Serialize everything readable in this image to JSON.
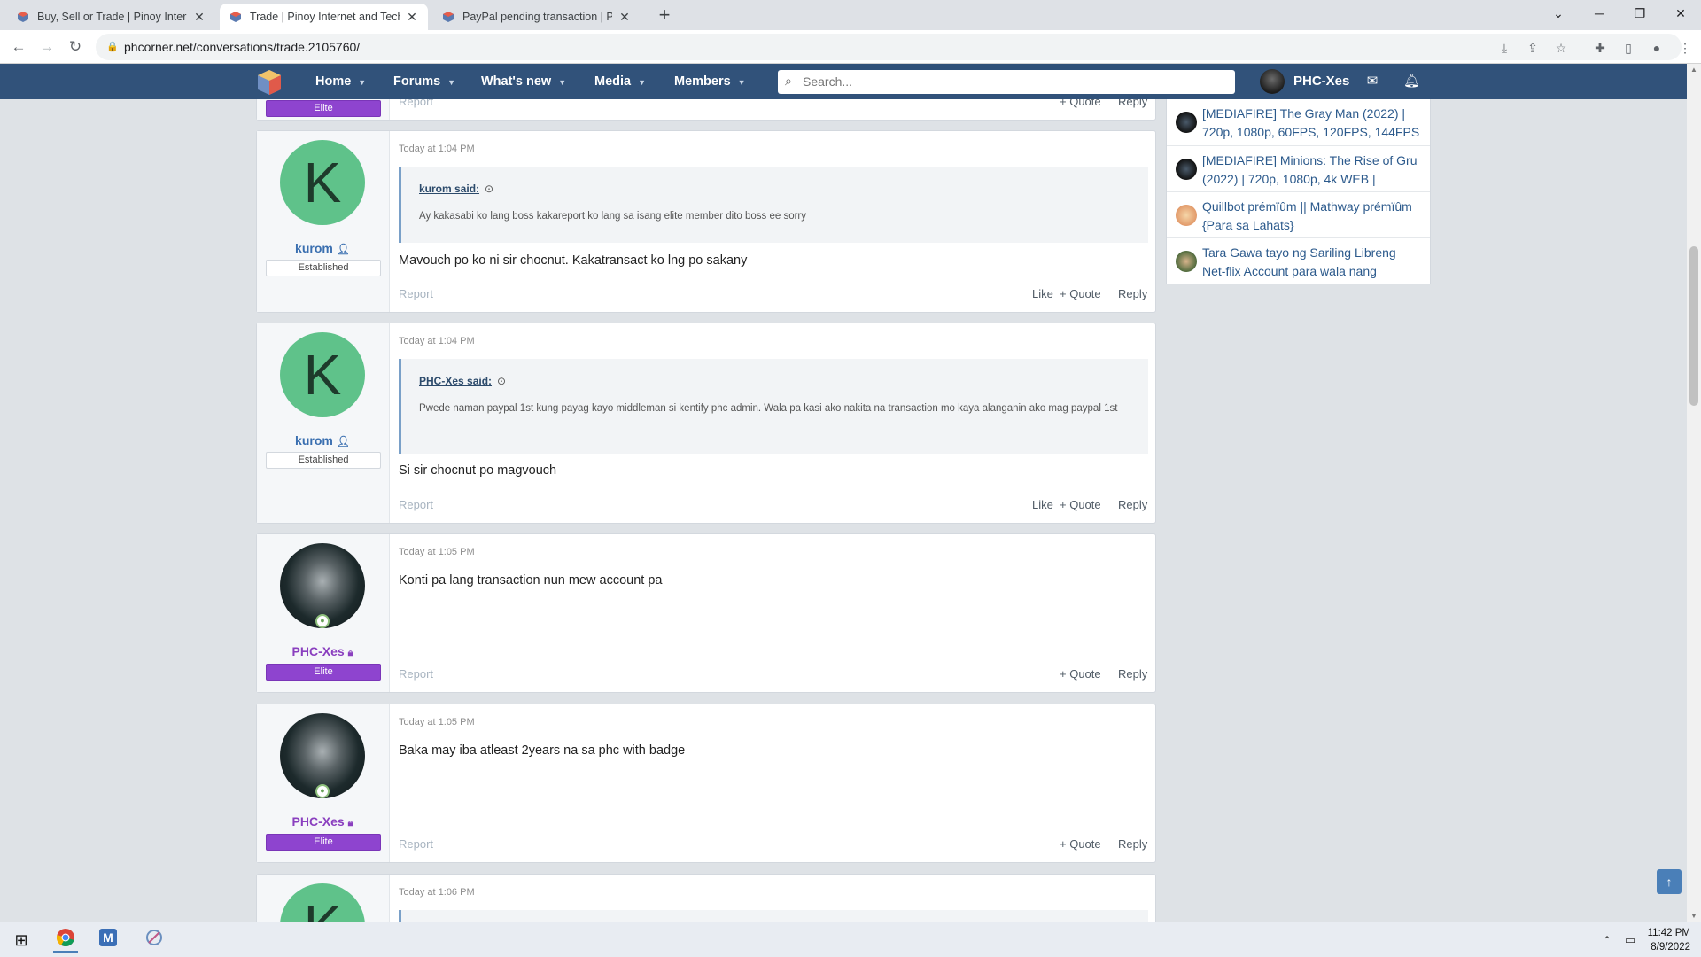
{
  "browser": {
    "tabs": [
      {
        "title": "Buy, Sell or Trade | Pinoy Internet and Technology Forums",
        "active": false
      },
      {
        "title": "Trade | Pinoy Internet and Technology Forums",
        "active": true
      },
      {
        "title": "PayPal pending transaction | Pinoy Internet",
        "active": false
      }
    ],
    "url": "phcorner.net/conversations/trade.2105760/"
  },
  "site_header": {
    "nav": [
      "Home",
      "Forums",
      "What's new",
      "Media",
      "Members"
    ],
    "search_placeholder": "Search...",
    "username": "PHC-Xes"
  },
  "partial_post_top": {
    "report": "Report",
    "quote": "Quote",
    "reply": "Reply",
    "badge": "Elite"
  },
  "posts": [
    {
      "author": "kurom",
      "avatar_letter": "K",
      "badge": "Established",
      "date": "Today at 1:04 PM",
      "quote_author": "kurom said:",
      "quote_text": "Ay kakasabi ko lang boss kakareport ko lang sa isang elite member dito boss ee sorry",
      "text": "Mavouch po ko ni sir chocnut. Kakatransact ko lng po sakany",
      "report": "Report",
      "like": "Like",
      "quote": "Quote",
      "reply": "Reply"
    },
    {
      "author": "kurom",
      "avatar_letter": "K",
      "badge": "Established",
      "date": "Today at 1:04 PM",
      "quote_author": "PHC-Xes said:",
      "quote_text": "Pwede naman paypal 1st kung payag kayo middleman si kentify phc admin. Wala pa kasi ako nakita na transaction mo kaya alanganin ako mag paypal 1st",
      "text": "Si sir chocnut po magvouch",
      "report": "Report",
      "like": "Like",
      "quote": "Quote",
      "reply": "Reply"
    },
    {
      "author": "PHC-Xes",
      "badge": "Elite",
      "date": "Today at 1:05 PM",
      "text": "Konti pa lang transaction nun mew account pa",
      "report": "Report",
      "quote": "Quote",
      "reply": "Reply"
    },
    {
      "author": "PHC-Xes",
      "badge": "Elite",
      "date": "Today at 1:05 PM",
      "text": "Baka may iba atleast 2years na sa phc with badge",
      "report": "Report",
      "quote": "Quote",
      "reply": "Reply"
    },
    {
      "author": "kurom",
      "avatar_letter": "K",
      "date": "Today at 1:06 PM"
    }
  ],
  "sidebar": {
    "items": [
      {
        "text": "[MEDIAFIRE] The Gray Man (2022) | 720p, 1080p, 60FPS, 120FPS, 144FPS",
        "icon": "dark-avatar-icon"
      },
      {
        "text": "[MEDIAFIRE] Minions: The Rise of Gru (2022) | 720p, 1080p, 4k WEB |",
        "icon": "dark-avatar-icon"
      },
      {
        "text": "Quillbot prémïûm || Mathway prémïûm {Para sa Lahats}",
        "icon": "cartoon-avatar-icon"
      },
      {
        "text": "Tara Gawa tayo ng Sariling Libreng Net-flix Account para wala nang",
        "icon": "photo-avatar-icon"
      }
    ]
  },
  "taskbar": {
    "time": "11:42 PM",
    "date": "8/9/2022"
  },
  "colors": {
    "header": "#31527a",
    "elite": "#8e44cf",
    "avatar_k": "#5fc28a"
  }
}
